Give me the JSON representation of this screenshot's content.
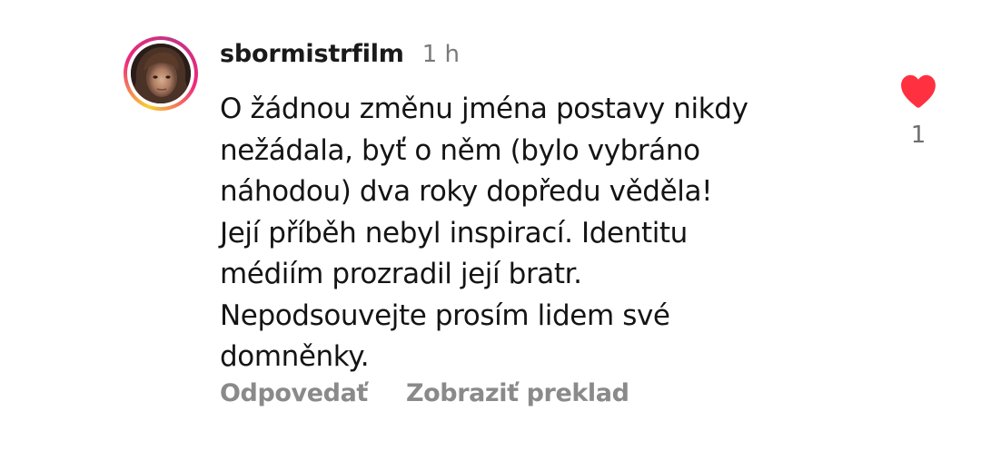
{
  "comment": {
    "username": "sbormistrfilm",
    "timestamp": "1 h",
    "text": "O žádnou změnu jména postavy nikdy\nnežádala, byť o něm (bylo vybráno\nnáhodou) dva roky dopředu věděla!\nJejí příběh nebyl inspirací. Identitu\nmédiím prozradil její bratr.\nNepodsouvejte prosím lidem své\ndomněnky.",
    "actions": {
      "reply_label": "Odpovedať",
      "translate_label": "Zobraziť preklad"
    },
    "likes": {
      "count": "1",
      "liked": true,
      "icon": "heart-icon",
      "color": "#ff3040"
    }
  },
  "colors": {
    "text": "#141414",
    "secondary": "#8a8a8a",
    "ring_start": "#f9ce34",
    "ring_end": "#ee2a7b"
  }
}
